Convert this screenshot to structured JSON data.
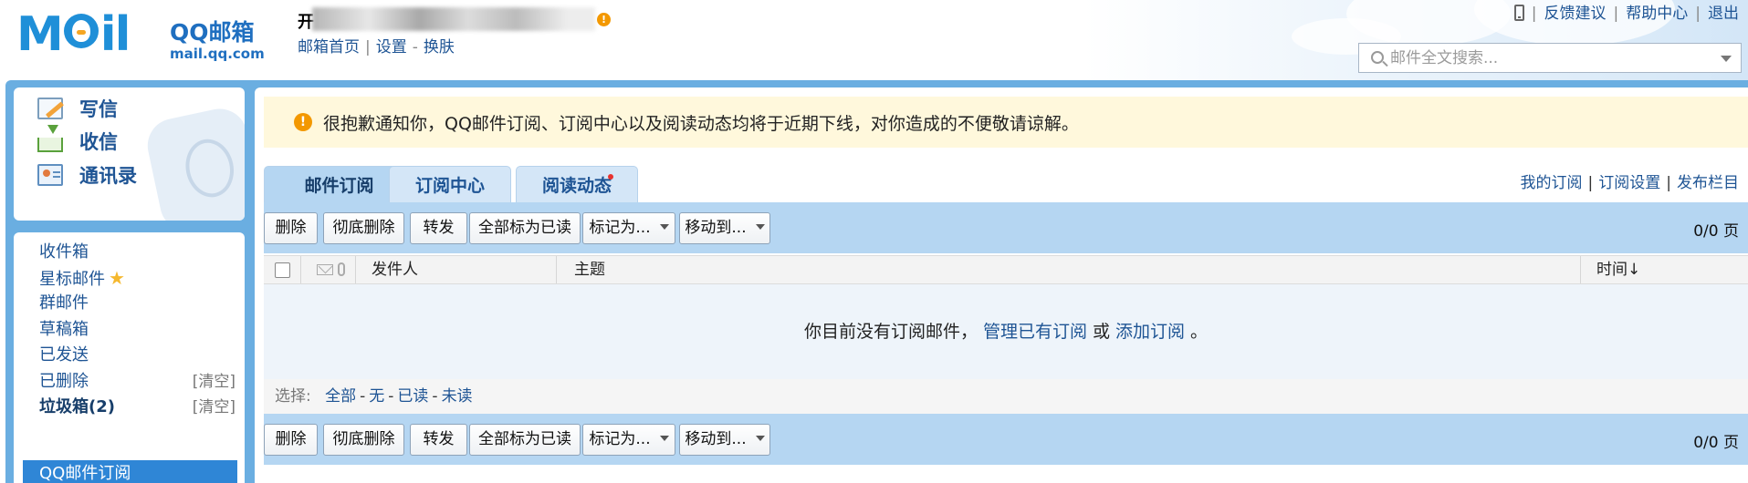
{
  "header": {
    "logo_mark": "M",
    "logo_mark_tail": "il",
    "logo_cn": "QQ邮箱",
    "logo_url": "mail.qq.com",
    "user_name": "开",
    "user_alert": "!",
    "user_links": [
      "邮箱首页",
      "设置",
      "换肤"
    ],
    "top_links": [
      "反馈建议",
      "帮助中心",
      "退出"
    ],
    "search_placeholder": "邮件全文搜索..."
  },
  "quick_nav": [
    {
      "label": "写信",
      "icon": "compose-icon"
    },
    {
      "label": "收信",
      "icon": "inbox-icon"
    },
    {
      "label": "通讯录",
      "icon": "contacts-icon"
    }
  ],
  "folders": {
    "inbox": "收件箱",
    "starred": "星标邮件",
    "group": "群邮件",
    "drafts": "草稿箱",
    "sent": "已发送",
    "deleted": "已删除",
    "spam": "垃圾箱(2)",
    "qq_subscriptions": "QQ邮件订阅",
    "clear_label": "[清空]"
  },
  "notice": {
    "icon": "!",
    "text": "很抱歉通知你，QQ邮件订阅、订阅中心以及阅读动态均将于近期下线，对你造成的不便敬请谅解。"
  },
  "tabs": [
    {
      "label": "邮件订阅",
      "active": true
    },
    {
      "label": "订阅中心",
      "active": false
    },
    {
      "label": "阅读动态",
      "active": false,
      "has_dot": true
    }
  ],
  "tab_links": [
    "我的订阅",
    "订阅设置",
    "发布栏目"
  ],
  "toolbar": {
    "delete": "删除",
    "delete_permanently": "彻底删除",
    "forward": "转发",
    "mark_all_read": "全部标为已读",
    "mark_as": "标记为...",
    "move_to": "移动到...",
    "pager": "0/0 页"
  },
  "list_header": {
    "sender": "发件人",
    "subject": "主题",
    "time": "时间↓"
  },
  "empty_state": {
    "prefix": "你目前没有订阅邮件，",
    "manage_link": "管理已有订阅",
    "or": "或",
    "add_link": "添加订阅",
    "suffix": "。"
  },
  "select_row": {
    "label": "选择:",
    "all": "全部",
    "none": "无",
    "read": "已读",
    "unread": "未读"
  },
  "colors": {
    "frame_blue": "#6aaee1",
    "toolbar_blue": "#b5d6f2",
    "link_blue": "#1e5494",
    "notice_bg": "#fff8dc",
    "alert_orange": "#f39800",
    "active_folder": "#2f86d6"
  }
}
